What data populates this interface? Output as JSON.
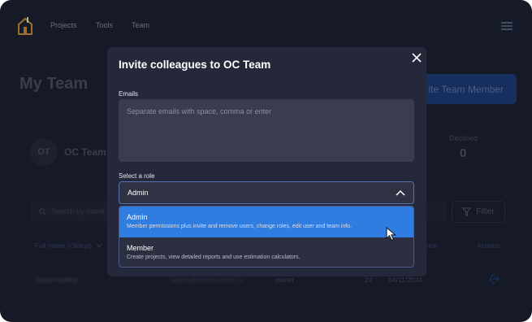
{
  "nav": {
    "items": [
      {
        "label": "Projects"
      },
      {
        "label": "Tools"
      },
      {
        "label": "Team"
      }
    ]
  },
  "page": {
    "title": "My Team",
    "invite_button": "ite Team Member",
    "team": {
      "avatar": "OT",
      "name": "OC Team",
      "declined_label": "Declined",
      "declined_value": "0"
    },
    "search_placeholder": "Search by name,",
    "filter_label": "Filter",
    "columns": {
      "full_name": "Full name (Oldest)",
      "invitations": "nce",
      "actions": "Actions"
    },
    "row": {
      "name": "Chad Hadley",
      "email": "hadley@construction.co",
      "role": "owner",
      "count": "24",
      "date": "04/11/2024"
    }
  },
  "modal": {
    "title": "Invite colleagues to OC Team",
    "emails_label": "Emails",
    "emails_placeholder": "Separate emails with space, comma or enter",
    "role_label": "Select a role",
    "selected_role": "Admin",
    "options": [
      {
        "title": "Admin",
        "description": "Member permissions plus invite and remove users, change roles, edit user and team info."
      },
      {
        "title": "Member",
        "description": "Create projects, view detailed reports and use estimation calculators."
      }
    ]
  },
  "colors": {
    "background": "#1b1e2d",
    "modal": "#25283a",
    "accent": "#2f7de0",
    "logo_orange": "#e8a23a"
  },
  "icons": {
    "logo": "house-logo-icon",
    "menu": "hamburger-icon",
    "close": "close-icon",
    "chevron": "chevron-up-icon",
    "search": "search-icon",
    "filter": "filter-icon",
    "sort": "chevron-down-icon",
    "row_action": "leave-icon",
    "cursor": "pointer-cursor-icon"
  }
}
